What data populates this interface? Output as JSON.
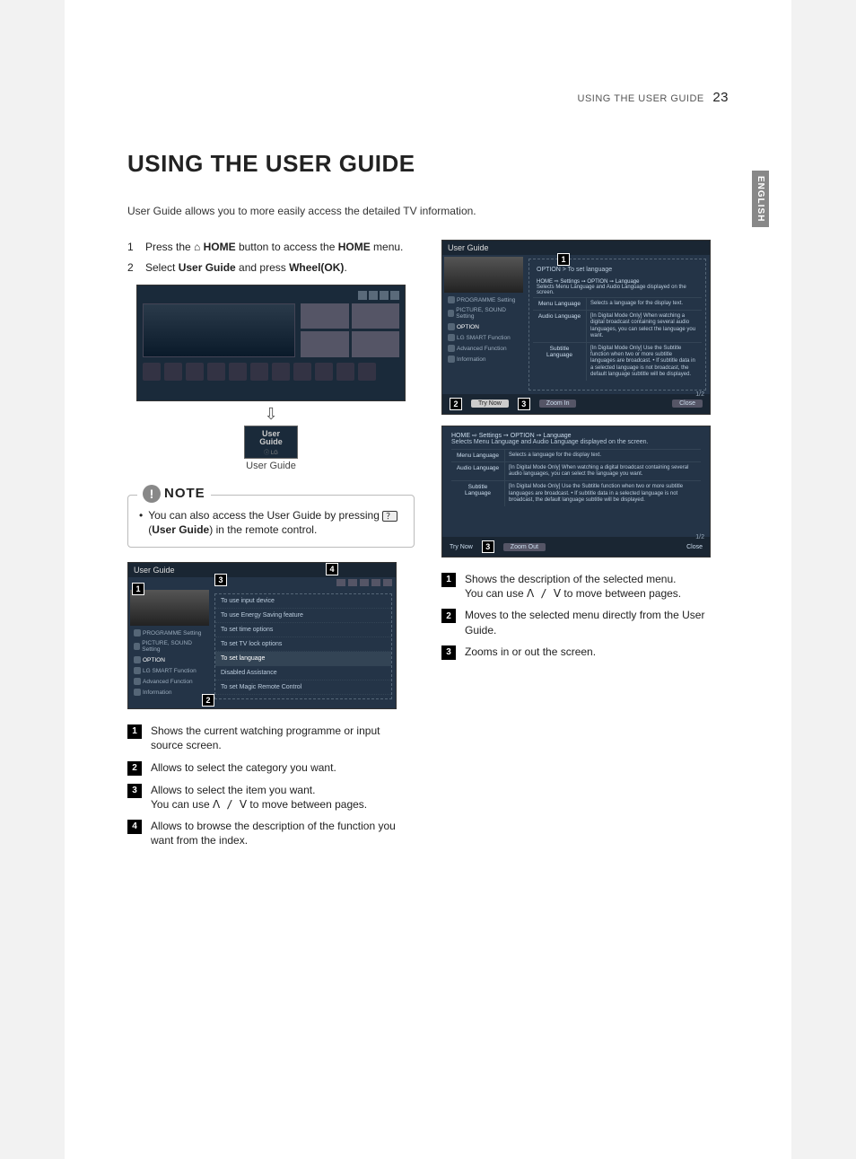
{
  "header": {
    "section": "USING THE USER GUIDE",
    "page": "23"
  },
  "language_tab": "ENGLISH",
  "title": "USING THE USER GUIDE",
  "intro": "User Guide allows you to more easily access the detailed TV information.",
  "steps": [
    {
      "num": "1",
      "pre": "Press the ",
      "icon": "⌂",
      "bold1": "HOME",
      "mid": " button to access the ",
      "bold2": "HOME",
      "post": " menu."
    },
    {
      "num": "2",
      "pre": "Select ",
      "bold1": "User Guide",
      "mid": " and press ",
      "bold2": "Wheel(OK)",
      "post": "."
    }
  ],
  "ug_icon": {
    "line1": "User",
    "line2": "Guide",
    "logo": "ⓘ LG"
  },
  "caption": "User Guide",
  "note": {
    "label": "NOTE",
    "items": [
      {
        "pre": "You can also access the User Guide by pressing ",
        "glyph": "？",
        "bold": "User Guide",
        "post": ") in the remote control."
      }
    ]
  },
  "panel1": {
    "title": "User Guide",
    "cats": [
      "PROGRAMME Setting",
      "PICTURE, SOUND Setting",
      "OPTION",
      "LG SMART Function",
      "Advanced Function",
      "Information"
    ],
    "items": [
      "To use input device",
      "To use Energy Saving feature",
      "To set time options",
      "To set TV lock options",
      "To set language",
      "Disabled Assistance",
      "To set Magic Remote Control"
    ],
    "badges": {
      "b1": "1",
      "b2": "2",
      "b3": "3",
      "b4": "4"
    }
  },
  "callouts_left": [
    "Shows the current watching programme or input source screen.",
    "Allows to select the category you want.",
    "",
    "Allows to browse the description of the function you want from the index."
  ],
  "callout_left_3a": "Allows to select the item you want.",
  "callout_left_3b_pre": "You can use ",
  "callout_left_3b_post": " to move between pages.",
  "panel2": {
    "title": "User Guide",
    "breadcrumb_label": "OPTION > To set language",
    "path": "HOME ⇨ Settings ➙ OPTION ➙ Language",
    "path_sub": "Selects Menu Language and Audio Language displayed on the screen.",
    "rows": [
      {
        "label": "Menu Language",
        "desc": "Selects a language for the display text."
      },
      {
        "label": "Audio Language",
        "desc": "[In Digital Mode Only]\nWhen watching a digital broadcast containing several audio languages, you can select the language you want."
      },
      {
        "label": "Subtitle Language",
        "desc": "[In Digital Mode Only]\nUse the Subtitle function when two or more subtitle languages are broadcast.\n• If subtitle data in a selected language is not broadcast, the default language subtitle will be displayed."
      }
    ],
    "foot": {
      "try": "Try Now",
      "zoom": "Zoom In",
      "close": "Close"
    },
    "badges": {
      "b1": "1",
      "b2": "2",
      "b3": "3"
    },
    "pagecount": "1/2"
  },
  "panel3": {
    "path": "HOME ⇨ Settings ➙ OPTION ➙ Language",
    "path_sub": "Selects Menu Language and Audio Language displayed on the screen.",
    "rows": [
      {
        "label": "Menu Language",
        "desc": "Selects a language for the display text."
      },
      {
        "label": "Audio Language",
        "desc": "[In Digital Mode Only]\nWhen watching a digital broadcast containing several audio languages, you can select the language you want."
      },
      {
        "label": "Subtitle Language",
        "desc": "[In Digital Mode Only]\nUse the Subtitle function when two or more subtitle languages are broadcast.\n• If subtitle data in a selected language is not broadcast, the default language subtitle will be displayed."
      }
    ],
    "foot": {
      "try": "Try Now",
      "zoom": "Zoom Out",
      "close": "Close"
    },
    "badges": {
      "b3": "3"
    },
    "pagecount": "1/2"
  },
  "callouts_right": [
    "",
    "Moves to the selected menu directly from the User Guide.",
    "Zooms in or out the screen."
  ],
  "callout_right_1a": "Shows the description of the selected menu.",
  "callout_right_1b_pre": "You can use ",
  "callout_right_1b_post": " to move between pages.",
  "arrows": "ꓥ / ꓦ"
}
